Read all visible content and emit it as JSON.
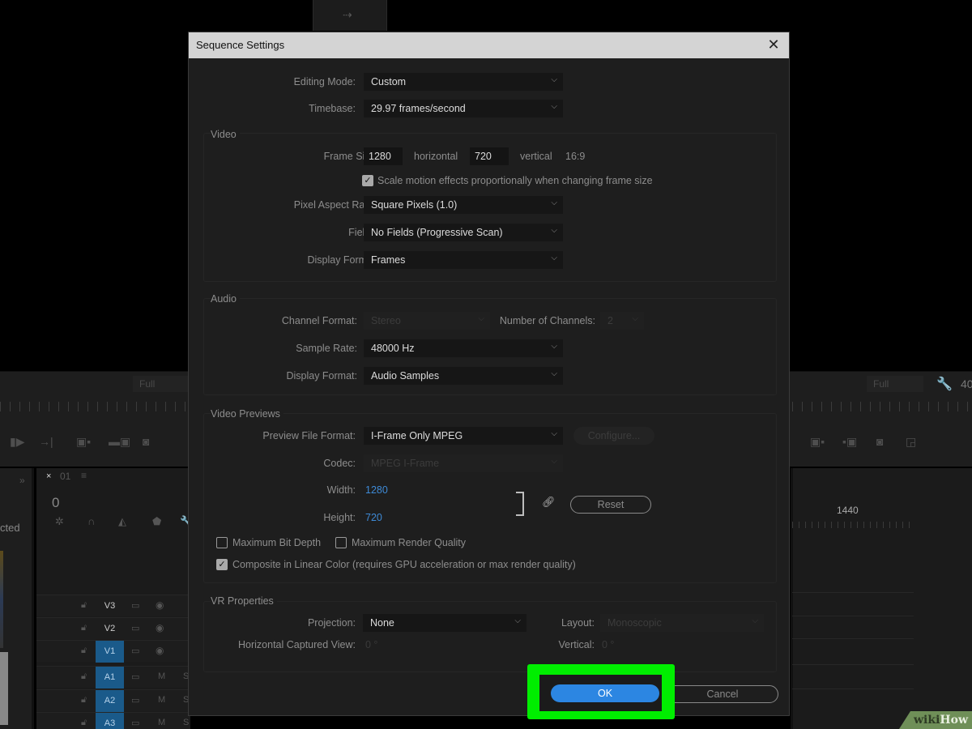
{
  "background": {
    "monitor_left": {
      "zoom_select": "Full"
    },
    "monitor_right": {
      "zoom_select": "Full",
      "timecode_partial": "40"
    },
    "left_panel": {
      "partial_text": "cted"
    },
    "timeline": {
      "sequence_name": "01",
      "timecode": "0",
      "tracks": [
        {
          "name": "V3",
          "targeted": false,
          "type": "video"
        },
        {
          "name": "V2",
          "targeted": false,
          "type": "video"
        },
        {
          "name": "V1",
          "targeted": true,
          "type": "video"
        },
        {
          "name": "A1",
          "targeted": true,
          "type": "audio",
          "mute": "M",
          "solo": "S"
        },
        {
          "name": "A2",
          "targeted": true,
          "type": "audio",
          "mute": "M",
          "solo": "S"
        },
        {
          "name": "A3",
          "targeted": true,
          "type": "audio",
          "mute": "M",
          "solo": "S"
        }
      ]
    },
    "right_ruler_label": "1440",
    "watermark": {
      "part1": "wiki",
      "part2": "How"
    }
  },
  "dialog": {
    "title": "Sequence Settings",
    "general": {
      "editing_mode": {
        "label": "Editing Mode:",
        "value": "Custom"
      },
      "timebase": {
        "label": "Timebase:",
        "value": "29.97  frames/second"
      }
    },
    "video": {
      "title": "Video",
      "frame_size": {
        "label": "Frame Size:",
        "horizontal": "1280",
        "horizontal_label": "horizontal",
        "vertical": "720",
        "vertical_label": "vertical",
        "aspect": "16:9"
      },
      "scale_motion": {
        "label": "Scale motion effects proportionally when changing frame size",
        "checked": true
      },
      "pixel_aspect_ratio": {
        "label": "Pixel Aspect Ratio:",
        "value": "Square Pixels (1.0)"
      },
      "fields": {
        "label": "Fields:",
        "value": "No Fields (Progressive Scan)"
      },
      "display_format": {
        "label": "Display Format:",
        "value": "Frames"
      }
    },
    "audio": {
      "title": "Audio",
      "channel_format": {
        "label": "Channel Format:",
        "value": "Stereo",
        "disabled": true
      },
      "number_of_channels": {
        "label": "Number of Channels:",
        "value": "2",
        "disabled": true
      },
      "sample_rate": {
        "label": "Sample Rate:",
        "value": "48000 Hz"
      },
      "display_format": {
        "label": "Display Format:",
        "value": "Audio Samples"
      }
    },
    "video_previews": {
      "title": "Video Previews",
      "preview_file_format": {
        "label": "Preview File Format:",
        "value": "I-Frame Only MPEG"
      },
      "configure_button": "Configure...",
      "codec": {
        "label": "Codec:",
        "value": "MPEG I-Frame",
        "disabled": true
      },
      "width": {
        "label": "Width:",
        "value": "1280"
      },
      "height": {
        "label": "Height:",
        "value": "720"
      },
      "reset_button": "Reset",
      "max_bit_depth": {
        "label": "Maximum Bit Depth",
        "checked": false
      },
      "max_render_quality": {
        "label": "Maximum Render Quality",
        "checked": false
      },
      "composite_linear": {
        "label": "Composite in Linear Color (requires GPU acceleration or max render quality)",
        "checked": true
      }
    },
    "vr_properties": {
      "title": "VR Properties",
      "projection": {
        "label": "Projection:",
        "value": "None"
      },
      "layout": {
        "label": "Layout:",
        "value": "Monoscopic",
        "disabled": true
      },
      "horizontal_captured_view": {
        "label": "Horizontal Captured View:",
        "value": "0 °"
      },
      "vertical": {
        "label": "Vertical:",
        "value": "0 °"
      }
    },
    "buttons": {
      "ok": "OK",
      "cancel": "Cancel"
    }
  },
  "colors": {
    "accent_blue": "#2c86e2",
    "highlight_green": "#00ee00",
    "track_target_blue": "#1a5a8a"
  }
}
